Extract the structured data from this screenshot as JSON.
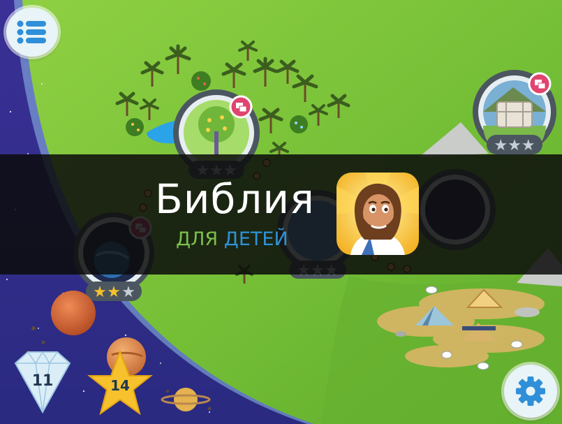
{
  "hud": {
    "menu_icon": "list-menu-icon",
    "settings_icon": "gear-icon",
    "gems": {
      "icon": "diamond-icon",
      "count": "11"
    },
    "stars": {
      "icon": "star-icon",
      "count": "14"
    }
  },
  "banner": {
    "title": "Библия",
    "subtitle_part1": "ДЛЯ",
    "subtitle_part2": "ДЕТЕЙ",
    "subtitle_color1": "#7cc04a",
    "subtitle_color2": "#2e92d8",
    "app_icon": "jesus-character-icon"
  },
  "map": {
    "levels": [
      {
        "id": "garden-tree",
        "stars_earned": 0,
        "stars_total": 3,
        "badge": "story-cards-icon"
      },
      {
        "id": "stone-altar",
        "stars_earned": 0,
        "stars_total": 3,
        "badge": "story-cards-icon"
      },
      {
        "id": "planets-orbit",
        "stars_earned": 2,
        "stars_total": 3,
        "badge": "story-cards-icon"
      },
      {
        "id": "rainbow-ark",
        "stars_earned": 0,
        "stars_total": 3,
        "badge": ""
      },
      {
        "id": "night-stars",
        "stars_earned": 0,
        "stars_total": 3,
        "badge": ""
      }
    ],
    "colors": {
      "grass": "#7cc63a",
      "space": "#2c2a86",
      "banner": "#0c0c0c"
    }
  }
}
